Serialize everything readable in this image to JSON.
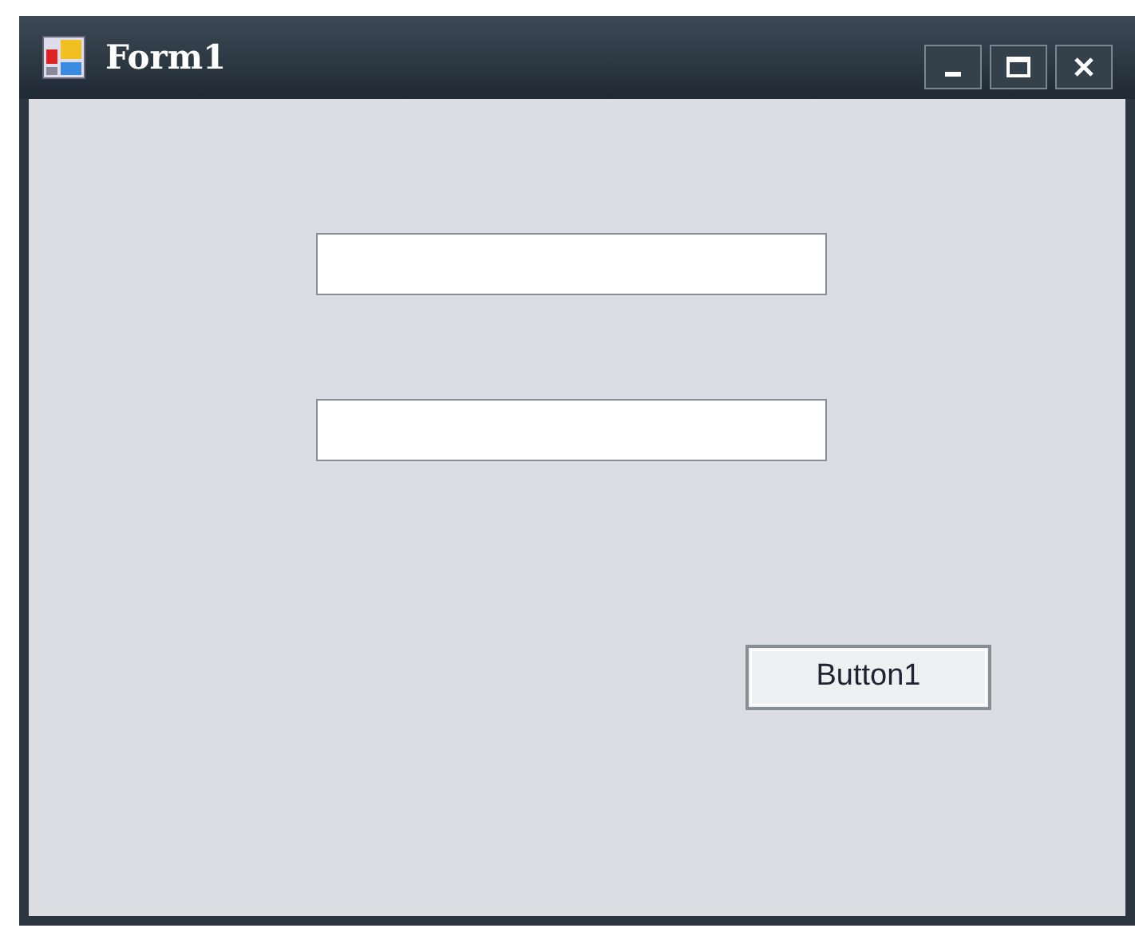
{
  "window": {
    "title": "Form1"
  },
  "buttons": [
    {
      "label": "Button1"
    }
  ]
}
